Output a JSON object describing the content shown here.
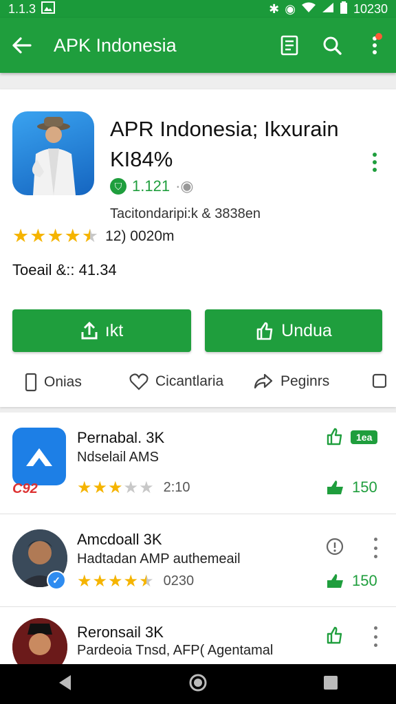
{
  "status_bar": {
    "left_text": "1.1.3",
    "right_text": "10230"
  },
  "app_bar": {
    "title": "APK Indonesia"
  },
  "app": {
    "title_line1": "APR Indonesia; Ikxurain",
    "title_line2": "KI84%",
    "version": "1.121",
    "developer": "Tacitondaripi:k & 3838en",
    "rating_stars": 4.5,
    "reviews": "12)  0020m",
    "size_line": "Toeail &:: 41.34",
    "btn_left": "ıkt",
    "btn_right": "Undua"
  },
  "tabs": [
    {
      "label": "Onias"
    },
    {
      "label": "Cicantlaria"
    },
    {
      "label": "Peginrs"
    }
  ],
  "list": [
    {
      "title": "Pernabal. 3K",
      "subtitle": "Ndselail AMS",
      "brand_mark": "C92",
      "rating_value": 3,
      "count": "2:10",
      "badge": "1ea",
      "likes": "150"
    },
    {
      "title": "Amcdoall 3K",
      "subtitle": "Hadtadan AMP authemeail",
      "rating_value": 4.5,
      "count": "0230",
      "likes": "150"
    },
    {
      "title": "Reronsail 3K",
      "subtitle": "Pardeoia Tnsd, AFP( Agentamal"
    }
  ],
  "colors": {
    "green": "#1f9e3d",
    "star": "#f5b400",
    "star_empty": "#c8c8c8"
  }
}
